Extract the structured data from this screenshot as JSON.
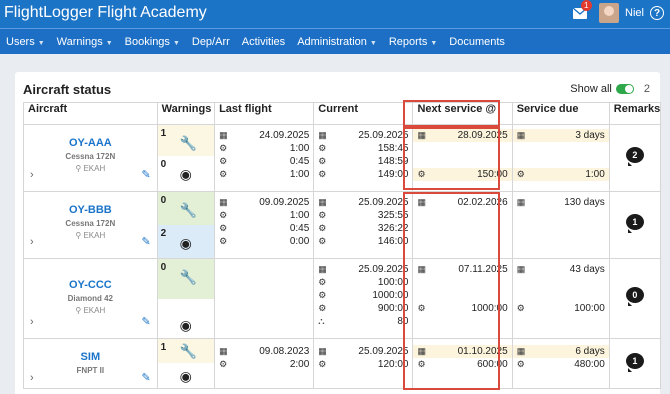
{
  "app": {
    "title": "FlightLogger Flight Academy",
    "mail_badge": "1",
    "user_name": "Niel",
    "help_label": "?"
  },
  "nav": [
    {
      "label": "Users",
      "dropdown": true
    },
    {
      "label": "Warnings",
      "dropdown": true
    },
    {
      "label": "Bookings",
      "dropdown": true
    },
    {
      "label": "Dep/Arr",
      "dropdown": false
    },
    {
      "label": "Activities",
      "dropdown": false
    },
    {
      "label": "Administration",
      "dropdown": true
    },
    {
      "label": "Reports",
      "dropdown": true
    },
    {
      "label": "Documents",
      "dropdown": false
    }
  ],
  "panel": {
    "title": "Aircraft status",
    "show_all_label": "Show all",
    "count": "2"
  },
  "columns": [
    "Aircraft",
    "Warnings",
    "Last flight",
    "Current",
    "Next service @",
    "Service due",
    "Remarks"
  ],
  "rows": [
    {
      "reg": "OY-AAA",
      "type": "Cessna 172N",
      "base": "EKAH",
      "warn1": "1",
      "warn2": "0",
      "last": [
        "24.09.2025",
        "1:00",
        "0:45",
        "1:00"
      ],
      "current": [
        "25.09.2025",
        "158:45",
        "148:59",
        "149:00"
      ],
      "next": [
        "28.09.2025",
        "",
        "",
        "150:00"
      ],
      "due": [
        "3 days",
        "",
        "",
        "1:00"
      ],
      "remarks": "2"
    },
    {
      "reg": "OY-BBB",
      "type": "Cessna 172N",
      "base": "EKAH",
      "warn1": "0",
      "warn2": "2",
      "last": [
        "09.09.2025",
        "1:00",
        "0:45",
        "0:00"
      ],
      "current": [
        "25.09.2025",
        "325:55",
        "326:22",
        "146:00"
      ],
      "next": [
        "02.02.2026"
      ],
      "due": [
        "130 days"
      ],
      "remarks": "1"
    },
    {
      "reg": "OY-CCC",
      "type": "Diamond 42",
      "base": "EKAH",
      "warn1": "0",
      "warn2": "",
      "last": [],
      "current": [
        "25.09.2025",
        "100:00",
        "1000:00",
        "900:00",
        "80"
      ],
      "next": [
        "07.11.2025",
        "",
        "",
        "1000:00"
      ],
      "due": [
        "43 days",
        "",
        "",
        "100:00"
      ],
      "remarks": "0"
    },
    {
      "reg": "SIM",
      "type": "FNPT II",
      "base": "",
      "warn1": "1",
      "warn2": "",
      "last": [
        "09.08.2023",
        "2:00"
      ],
      "current": [
        "25.09.2025",
        "120:00"
      ],
      "next": [
        "01.10.2025",
        "600:00"
      ],
      "due": [
        "6 days",
        "480:00"
      ],
      "remarks": "1"
    }
  ]
}
